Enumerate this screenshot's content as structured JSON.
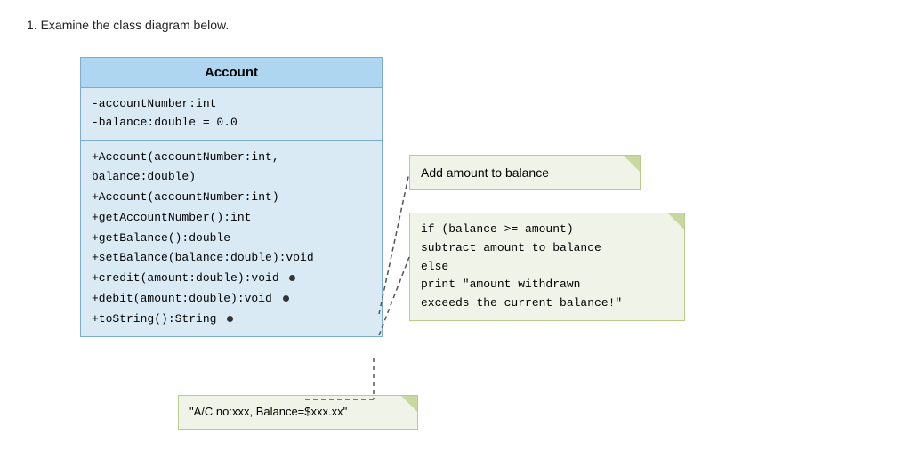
{
  "intro": {
    "text": "1.   Examine the class diagram below."
  },
  "uml": {
    "className": "Account",
    "attributes": [
      "-accountNumber:int",
      "-balance:double = 0.0"
    ],
    "methods": [
      "+Account(accountNumber:int,",
      "    balance:double)",
      "+Account(accountNumber:int)",
      "+getAccountNumber():int",
      "+getBalance():double",
      "+setBalance(balance:double):void",
      "+credit(amount:double):void",
      "+debit(amount:double):void",
      "+toString():String"
    ]
  },
  "notes": {
    "add_amount": "Add amount to balance",
    "debit_logic_lines": [
      "if (balance >= amount)",
      "  subtract amount to balance",
      "else",
      "  print \"amount withdrawn",
      "  exceeds the current balance!\""
    ],
    "tostring_value": "\"A/C no:xxx, Balance=$xxx.xx\""
  }
}
